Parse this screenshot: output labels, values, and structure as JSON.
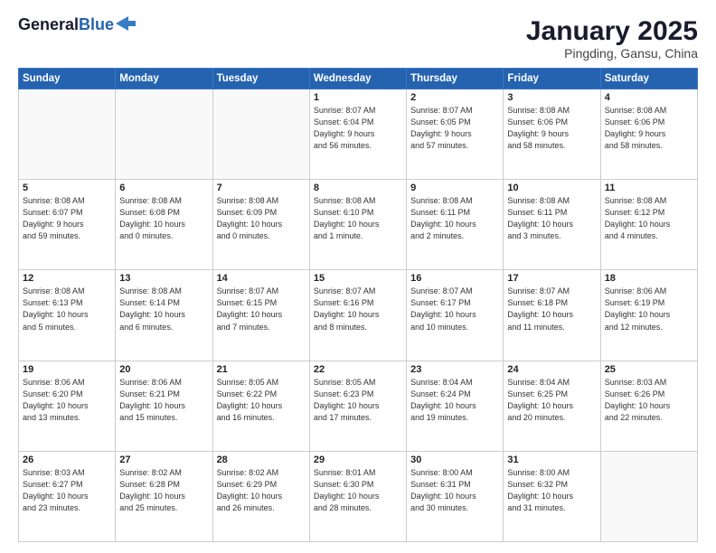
{
  "header": {
    "logo_line1": "General",
    "logo_line2": "Blue",
    "title": "January 2025",
    "subtitle": "Pingding, Gansu, China"
  },
  "days_of_week": [
    "Sunday",
    "Monday",
    "Tuesday",
    "Wednesday",
    "Thursday",
    "Friday",
    "Saturday"
  ],
  "weeks": [
    [
      {
        "day": "",
        "info": ""
      },
      {
        "day": "",
        "info": ""
      },
      {
        "day": "",
        "info": ""
      },
      {
        "day": "1",
        "info": "Sunrise: 8:07 AM\nSunset: 6:04 PM\nDaylight: 9 hours\nand 56 minutes."
      },
      {
        "day": "2",
        "info": "Sunrise: 8:07 AM\nSunset: 6:05 PM\nDaylight: 9 hours\nand 57 minutes."
      },
      {
        "day": "3",
        "info": "Sunrise: 8:08 AM\nSunset: 6:06 PM\nDaylight: 9 hours\nand 58 minutes."
      },
      {
        "day": "4",
        "info": "Sunrise: 8:08 AM\nSunset: 6:06 PM\nDaylight: 9 hours\nand 58 minutes."
      }
    ],
    [
      {
        "day": "5",
        "info": "Sunrise: 8:08 AM\nSunset: 6:07 PM\nDaylight: 9 hours\nand 59 minutes."
      },
      {
        "day": "6",
        "info": "Sunrise: 8:08 AM\nSunset: 6:08 PM\nDaylight: 10 hours\nand 0 minutes."
      },
      {
        "day": "7",
        "info": "Sunrise: 8:08 AM\nSunset: 6:09 PM\nDaylight: 10 hours\nand 0 minutes."
      },
      {
        "day": "8",
        "info": "Sunrise: 8:08 AM\nSunset: 6:10 PM\nDaylight: 10 hours\nand 1 minute."
      },
      {
        "day": "9",
        "info": "Sunrise: 8:08 AM\nSunset: 6:11 PM\nDaylight: 10 hours\nand 2 minutes."
      },
      {
        "day": "10",
        "info": "Sunrise: 8:08 AM\nSunset: 6:11 PM\nDaylight: 10 hours\nand 3 minutes."
      },
      {
        "day": "11",
        "info": "Sunrise: 8:08 AM\nSunset: 6:12 PM\nDaylight: 10 hours\nand 4 minutes."
      }
    ],
    [
      {
        "day": "12",
        "info": "Sunrise: 8:08 AM\nSunset: 6:13 PM\nDaylight: 10 hours\nand 5 minutes."
      },
      {
        "day": "13",
        "info": "Sunrise: 8:08 AM\nSunset: 6:14 PM\nDaylight: 10 hours\nand 6 minutes."
      },
      {
        "day": "14",
        "info": "Sunrise: 8:07 AM\nSunset: 6:15 PM\nDaylight: 10 hours\nand 7 minutes."
      },
      {
        "day": "15",
        "info": "Sunrise: 8:07 AM\nSunset: 6:16 PM\nDaylight: 10 hours\nand 8 minutes."
      },
      {
        "day": "16",
        "info": "Sunrise: 8:07 AM\nSunset: 6:17 PM\nDaylight: 10 hours\nand 10 minutes."
      },
      {
        "day": "17",
        "info": "Sunrise: 8:07 AM\nSunset: 6:18 PM\nDaylight: 10 hours\nand 11 minutes."
      },
      {
        "day": "18",
        "info": "Sunrise: 8:06 AM\nSunset: 6:19 PM\nDaylight: 10 hours\nand 12 minutes."
      }
    ],
    [
      {
        "day": "19",
        "info": "Sunrise: 8:06 AM\nSunset: 6:20 PM\nDaylight: 10 hours\nand 13 minutes."
      },
      {
        "day": "20",
        "info": "Sunrise: 8:06 AM\nSunset: 6:21 PM\nDaylight: 10 hours\nand 15 minutes."
      },
      {
        "day": "21",
        "info": "Sunrise: 8:05 AM\nSunset: 6:22 PM\nDaylight: 10 hours\nand 16 minutes."
      },
      {
        "day": "22",
        "info": "Sunrise: 8:05 AM\nSunset: 6:23 PM\nDaylight: 10 hours\nand 17 minutes."
      },
      {
        "day": "23",
        "info": "Sunrise: 8:04 AM\nSunset: 6:24 PM\nDaylight: 10 hours\nand 19 minutes."
      },
      {
        "day": "24",
        "info": "Sunrise: 8:04 AM\nSunset: 6:25 PM\nDaylight: 10 hours\nand 20 minutes."
      },
      {
        "day": "25",
        "info": "Sunrise: 8:03 AM\nSunset: 6:26 PM\nDaylight: 10 hours\nand 22 minutes."
      }
    ],
    [
      {
        "day": "26",
        "info": "Sunrise: 8:03 AM\nSunset: 6:27 PM\nDaylight: 10 hours\nand 23 minutes."
      },
      {
        "day": "27",
        "info": "Sunrise: 8:02 AM\nSunset: 6:28 PM\nDaylight: 10 hours\nand 25 minutes."
      },
      {
        "day": "28",
        "info": "Sunrise: 8:02 AM\nSunset: 6:29 PM\nDaylight: 10 hours\nand 26 minutes."
      },
      {
        "day": "29",
        "info": "Sunrise: 8:01 AM\nSunset: 6:30 PM\nDaylight: 10 hours\nand 28 minutes."
      },
      {
        "day": "30",
        "info": "Sunrise: 8:00 AM\nSunset: 6:31 PM\nDaylight: 10 hours\nand 30 minutes."
      },
      {
        "day": "31",
        "info": "Sunrise: 8:00 AM\nSunset: 6:32 PM\nDaylight: 10 hours\nand 31 minutes."
      },
      {
        "day": "",
        "info": ""
      }
    ]
  ]
}
